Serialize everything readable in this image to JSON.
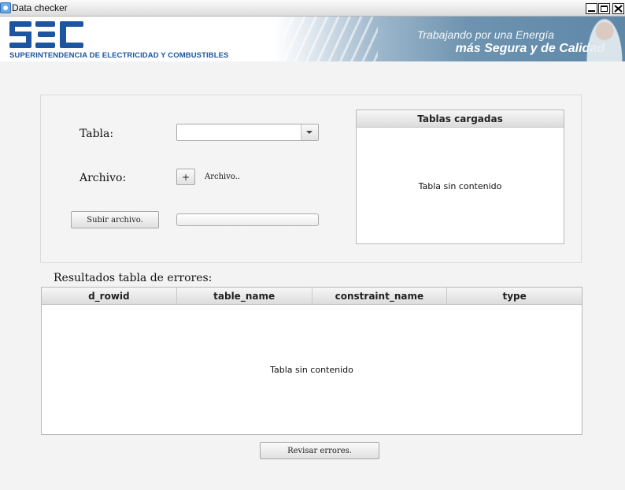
{
  "window": {
    "title": "Data checker"
  },
  "banner": {
    "logo_text": "SEC",
    "organization": "SUPERINTENDENCIA DE ELECTRICIDAD Y COMBUSTIBLES",
    "slogan_line1": "Trabajando por una Energía",
    "slogan_line2": "más Segura y de Calidad"
  },
  "upload": {
    "table_label": "Tabla:",
    "table_select_value": "",
    "file_label": "Archivo:",
    "file_add_button": "+",
    "file_name": "Archivo..",
    "upload_button": "Subir archivo.",
    "upload_progress": 0
  },
  "loaded_tables": {
    "header": "Tablas cargadas",
    "empty_message": "Tabla sin contenido"
  },
  "results": {
    "title": "Resultados tabla de errores:",
    "columns": [
      "d_rowid",
      "table_name",
      "constraint_name",
      "type"
    ],
    "empty_message": "Tabla sin contenido",
    "check_button": "Revisar errores."
  },
  "colors": {
    "brand_blue": "#1d55a0",
    "window_bg": "#f3f3f3"
  }
}
